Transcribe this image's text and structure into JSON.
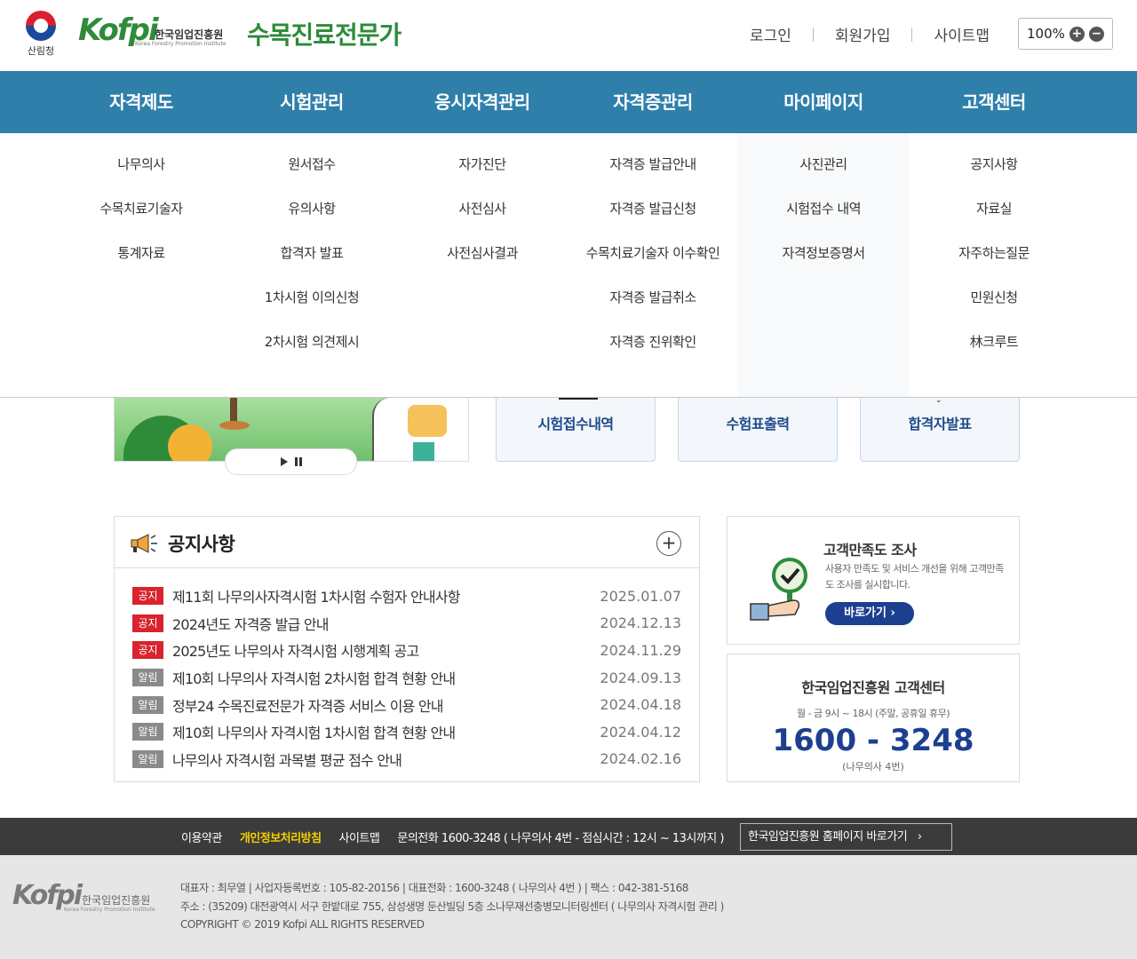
{
  "header": {
    "gov_name": "산림청",
    "org_logo_mark": "Kofpi",
    "org_name": "한국임업진흥원",
    "org_sub": "Korea Forestry Promotion Institute",
    "site_title": "수목진료전문가",
    "links": [
      "로그인",
      "회원가입",
      "사이트맵"
    ],
    "zoom": "100%"
  },
  "gnb": {
    "items": [
      "자격제도",
      "시험관리",
      "응시자격관리",
      "자격증관리",
      "마이페이지",
      "고객센터"
    ]
  },
  "mega": {
    "columns": [
      [
        "나무의사",
        "수목치료기술자",
        "통계자료"
      ],
      [
        "원서접수",
        "유의사항",
        "합격자 발표",
        "1차시험 이의신청",
        "2차시험 의견제시"
      ],
      [
        "자가진단",
        "사전심사",
        "사전심사결과"
      ],
      [
        "자격증 발급안내",
        "자격증 발급신청",
        "수목치료기술자 이수확인",
        "자격증 발급취소",
        "자격증 진위확인"
      ],
      [
        "사진관리",
        "시험접수 내역",
        "자격정보증명서"
      ],
      [
        "공지사항",
        "자료실",
        "자주하는질문",
        "민원신청",
        "林크루트"
      ]
    ]
  },
  "quick": {
    "items": [
      "시험접수내역",
      "수험표출력",
      "합격자발표"
    ]
  },
  "notice": {
    "title": "공지사항",
    "items": [
      {
        "tag": "공지",
        "type": "notice",
        "title": "제11회 나무의사자격시험 1차시험 수험자 안내사항",
        "date": "2025.01.07"
      },
      {
        "tag": "공지",
        "type": "notice",
        "title": "2024년도 자격증 발급 안내",
        "date": "2024.12.13"
      },
      {
        "tag": "공지",
        "type": "notice",
        "title": "2025년도 나무의사 자격시험 시행계획 공고",
        "date": "2024.11.29"
      },
      {
        "tag": "알림",
        "type": "alert",
        "title": "제10회 나무의사 자격시험 2차시험 합격 현황 안내",
        "date": "2024.09.13"
      },
      {
        "tag": "알림",
        "type": "alert",
        "title": "정부24 수목진료전문가 자격증 서비스 이용 안내",
        "date": "2024.04.18"
      },
      {
        "tag": "알림",
        "type": "alert",
        "title": "제10회 나무의사 자격시험 1차시험 합격 현황 안내",
        "date": "2024.04.12"
      },
      {
        "tag": "알림",
        "type": "alert",
        "title": "나무의사 자격시험 과목별 평균 점수 안내",
        "date": "2024.02.16"
      }
    ]
  },
  "survey": {
    "title": "고객만족도 조사",
    "desc": "사용자 만족도 및 서비스 개선을 위해 고객만족도 조사를 실시합니다.",
    "button": "바로가기 ›"
  },
  "callcenter": {
    "title": "한국임업진흥원 고객센터",
    "hours": "월 - 금 9시 ~ 18시 (주말, 공휴일 휴무)",
    "phone": "1600 - 3248",
    "ext": "(나무의사 4번)"
  },
  "footer": {
    "links": [
      "이용약관",
      "개인정보처리방침",
      "사이트맵",
      "문의전화 1600-3248 ( 나무의사 4번 - 점심시간 : 12시 ~ 13시까지 )"
    ],
    "home_button": "한국임업진흥원 홈페이지 바로가기",
    "info_line1": "대표자 : 최무열 | 사업자등록번호 : 105-82-20156 | 대표전화 : 1600-3248 ( 나무의사 4번 ) | 팩스 : 042-381-5168",
    "info_line2": "주소 : (35209) 대전광역시 서구 한밭대로 755, 삼성생명 둔산빌딩 5층 소나무재선충병모니터링센터 ( 나무의사 자격시험 관리 )",
    "copyright": "COPYRIGHT © 2019 Kofpi ALL RIGHTS RESERVED"
  },
  "colors": {
    "gnb": "#2f7fab",
    "title_green": "#2e8b3a",
    "notice_tag": "#d9232e",
    "alert_tag": "#8a8a8a",
    "navy": "#1d3f8f"
  }
}
